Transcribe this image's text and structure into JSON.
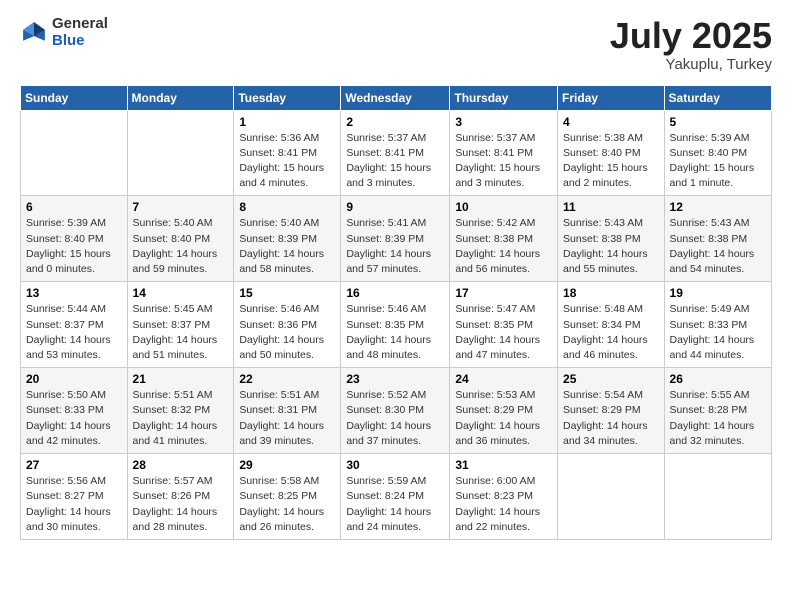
{
  "header": {
    "logo_general": "General",
    "logo_blue": "Blue",
    "month_title": "July 2025",
    "location": "Yakuplu, Turkey"
  },
  "days_of_week": [
    "Sunday",
    "Monday",
    "Tuesday",
    "Wednesday",
    "Thursday",
    "Friday",
    "Saturday"
  ],
  "weeks": [
    [
      {
        "num": "",
        "info": ""
      },
      {
        "num": "",
        "info": ""
      },
      {
        "num": "1",
        "info": "Sunrise: 5:36 AM\nSunset: 8:41 PM\nDaylight: 15 hours and 4 minutes."
      },
      {
        "num": "2",
        "info": "Sunrise: 5:37 AM\nSunset: 8:41 PM\nDaylight: 15 hours and 3 minutes."
      },
      {
        "num": "3",
        "info": "Sunrise: 5:37 AM\nSunset: 8:41 PM\nDaylight: 15 hours and 3 minutes."
      },
      {
        "num": "4",
        "info": "Sunrise: 5:38 AM\nSunset: 8:40 PM\nDaylight: 15 hours and 2 minutes."
      },
      {
        "num": "5",
        "info": "Sunrise: 5:39 AM\nSunset: 8:40 PM\nDaylight: 15 hours and 1 minute."
      }
    ],
    [
      {
        "num": "6",
        "info": "Sunrise: 5:39 AM\nSunset: 8:40 PM\nDaylight: 15 hours and 0 minutes."
      },
      {
        "num": "7",
        "info": "Sunrise: 5:40 AM\nSunset: 8:40 PM\nDaylight: 14 hours and 59 minutes."
      },
      {
        "num": "8",
        "info": "Sunrise: 5:40 AM\nSunset: 8:39 PM\nDaylight: 14 hours and 58 minutes."
      },
      {
        "num": "9",
        "info": "Sunrise: 5:41 AM\nSunset: 8:39 PM\nDaylight: 14 hours and 57 minutes."
      },
      {
        "num": "10",
        "info": "Sunrise: 5:42 AM\nSunset: 8:38 PM\nDaylight: 14 hours and 56 minutes."
      },
      {
        "num": "11",
        "info": "Sunrise: 5:43 AM\nSunset: 8:38 PM\nDaylight: 14 hours and 55 minutes."
      },
      {
        "num": "12",
        "info": "Sunrise: 5:43 AM\nSunset: 8:38 PM\nDaylight: 14 hours and 54 minutes."
      }
    ],
    [
      {
        "num": "13",
        "info": "Sunrise: 5:44 AM\nSunset: 8:37 PM\nDaylight: 14 hours and 53 minutes."
      },
      {
        "num": "14",
        "info": "Sunrise: 5:45 AM\nSunset: 8:37 PM\nDaylight: 14 hours and 51 minutes."
      },
      {
        "num": "15",
        "info": "Sunrise: 5:46 AM\nSunset: 8:36 PM\nDaylight: 14 hours and 50 minutes."
      },
      {
        "num": "16",
        "info": "Sunrise: 5:46 AM\nSunset: 8:35 PM\nDaylight: 14 hours and 48 minutes."
      },
      {
        "num": "17",
        "info": "Sunrise: 5:47 AM\nSunset: 8:35 PM\nDaylight: 14 hours and 47 minutes."
      },
      {
        "num": "18",
        "info": "Sunrise: 5:48 AM\nSunset: 8:34 PM\nDaylight: 14 hours and 46 minutes."
      },
      {
        "num": "19",
        "info": "Sunrise: 5:49 AM\nSunset: 8:33 PM\nDaylight: 14 hours and 44 minutes."
      }
    ],
    [
      {
        "num": "20",
        "info": "Sunrise: 5:50 AM\nSunset: 8:33 PM\nDaylight: 14 hours and 42 minutes."
      },
      {
        "num": "21",
        "info": "Sunrise: 5:51 AM\nSunset: 8:32 PM\nDaylight: 14 hours and 41 minutes."
      },
      {
        "num": "22",
        "info": "Sunrise: 5:51 AM\nSunset: 8:31 PM\nDaylight: 14 hours and 39 minutes."
      },
      {
        "num": "23",
        "info": "Sunrise: 5:52 AM\nSunset: 8:30 PM\nDaylight: 14 hours and 37 minutes."
      },
      {
        "num": "24",
        "info": "Sunrise: 5:53 AM\nSunset: 8:29 PM\nDaylight: 14 hours and 36 minutes."
      },
      {
        "num": "25",
        "info": "Sunrise: 5:54 AM\nSunset: 8:29 PM\nDaylight: 14 hours and 34 minutes."
      },
      {
        "num": "26",
        "info": "Sunrise: 5:55 AM\nSunset: 8:28 PM\nDaylight: 14 hours and 32 minutes."
      }
    ],
    [
      {
        "num": "27",
        "info": "Sunrise: 5:56 AM\nSunset: 8:27 PM\nDaylight: 14 hours and 30 minutes."
      },
      {
        "num": "28",
        "info": "Sunrise: 5:57 AM\nSunset: 8:26 PM\nDaylight: 14 hours and 28 minutes."
      },
      {
        "num": "29",
        "info": "Sunrise: 5:58 AM\nSunset: 8:25 PM\nDaylight: 14 hours and 26 minutes."
      },
      {
        "num": "30",
        "info": "Sunrise: 5:59 AM\nSunset: 8:24 PM\nDaylight: 14 hours and 24 minutes."
      },
      {
        "num": "31",
        "info": "Sunrise: 6:00 AM\nSunset: 8:23 PM\nDaylight: 14 hours and 22 minutes."
      },
      {
        "num": "",
        "info": ""
      },
      {
        "num": "",
        "info": ""
      }
    ]
  ]
}
